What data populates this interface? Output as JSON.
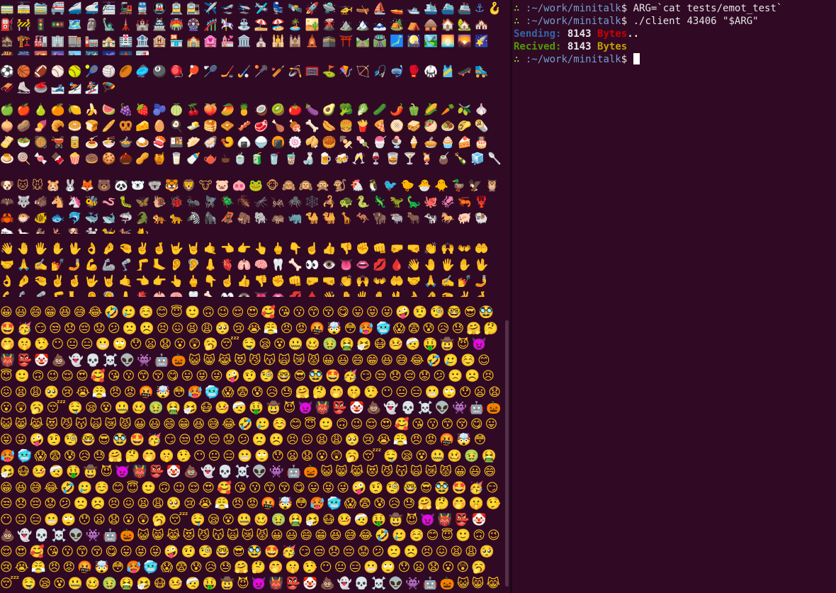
{
  "left_terminal": {
    "travel_emoji": "🚃🚋🚞🚝🚄🚅🚈🚂🚆🚇🚊🚉✈️🛫🛬🛩️💺🛰️🚀🛸🚁🛶⛵🚤🛥️🛳️⛴️🚢⚓🪝⛽🚧🚦🚥🗺️🗿🗽🗼🏰🏯🏟️🎡🎢🎠⛲⛱️🏖️🏝️🏜️🌋⛰️🏔️🗻🏕️⛺🛖🏠🏡🏘️🏚️🏗️🏭🏢🏬🏣🏤🏥🏦🏨🏪🏫🏩💒🏛️⛪🕌🕍🛕🕋⛩️🛤️🛣️🗾🎑🏞️🌅🌄🌠🎇🎆🌇🌆🏙️🌃🌌🌉🌁",
    "sport_emoji": "⚽🏀🏈⚾🥎🎾🏐🏉🥏🎱🪀🏓🏸🏒🏑🥍🏏🪃🥅⛳🪁🏹🎣🤿🥊🥋🎽🛹🛼🛷⛸️🥌🎿⛷️🏂🪂",
    "food_emoji": "🍏🍎🍐🍊🍋🍌🍉🍇🍓🫐🍈🍒🍑🥭🍍🥥🥝🍅🍆🥑🥦🥬🥒🌶️🫑🌽🥕🫒🧄🧅🥔🍠🥐🥯🍞🥖🥨🧀🥚🍳🧈🥞🧇🥓🥩🍗🍖🦴🌭🍔🍟🍕🫓🥪🥙🧆🌮🌯🫔🥗🥘🫕🥫🍝🍜🍲🍛🍣🍱🥟🦪🍤🍙🍚🍘🍥🥠🥮🍢🍡🍧🍨🍦🥧🧁🍰🎂🍮🍭🍬🍫🍿🍩🍪🌰🥜🍯🥛🍼🫖☕🍵🧃🥤🧋🍶🍺🍻🥂🍷🥃🍸🍹🧉🍾🧊🥄🍴🍽️🥣🥡🥢🧂",
    "animal_emoji": "🐶🐱🐭🐹🐰🦊🐻🐼🐻‍❄️🐨🐯🦁🐮🐷🐽🐸🐵🙈🙉🙊🐒🐔🐧🐦🐤🐣🐥🦆🦅🦉🦇🐺🐗🐴🦄🐝🪱🐛🦋🐌🐞🐜🪰🪲🪳🦟🦗🕷️🕸️🦂🐢🐍🦎🦖🦕🐙🦑🦐🦞🦀🐡🐠🐟🐬🐳🐋🦈🐊🐅🐆🦓🦍🦧🦣🐘🦛🦏🐪🐫🦒🦘🦬🐃🐂🐄🐎🐖🐏🐑🦙🐐🦌🐕🐩🦮🐕‍🦺🐈",
    "hands_emoji": "👋🤚🖐️✋🖖👌🤌🤏✌️🤞🤟🤘🤙👈👉👆🖕👇☝️👍👎✊👊🤛🤜👏🙌👐🤲🤝🙏✍️💅🤳💪🦾🦿🦵🦶👂🦻👃🫀🫁🧠🦷🦴👀👁️👅👄💋🩸👋🤚🖐️✋🖖👌🤌🤏✌️🤞🤟🤘🤙👈👉👆🖕👇☝️👍👎✊👊🤛🤜👏🙌👐🤲🤝🙏✍️💅🤳💪🦾🦿🦵🦶👂🦻👃🫀🫁🧠🦷🦴👀👁️👅👄💋🩸👋🤚🖐️✋🖖👌🤌🤏✌️🤞🤟🤘🤙👈👉👆🖕👇☝️👍👎✊👊🤛🤜👏🙌👐🤲🤝🙏✍️💅🤳💪🦾🦿🦵🦶👂🦻👃🫀🫁🧠🦷🦴👀👁️👅👄💋🩸",
    "faces_emoji": "😀😃😄😁😆😅😂🤣🥲☺️😊😇🙂🙃😉😌😍🥰😘😗😙😚😋😛😝😜🤪🤨🧐🤓😎🥸🤩🥳😏😒😞😔😟😕🙁☹️😣😖😫😩🥺😢😭😤😠😡🤬🤯😳🥵🥶😱😨😰😥😓🤗🤔🤭🤫🤥😶😐😑😬🙄😯😦😧😮😲🥱😴🤤😪😵🤐🥴🤢🤮🤧😷🤒🤕🤑🤠😈👿👹👺🤡💩👻💀☠️👽👾🤖🎃😺😸😹😻😼😽🙀😿😾😀😃😄😁😆😅😂🤣🥲☺️😊😇🙂🙃😉😌😍🥰😘😗😙😚😋😛😝😜🤪🤨🧐🤓😎🥸🤩🥳😏😒😞😔😟😕🙁☹️😣😖😫😩🥺😢😭😤😠😡🤬🤯😳🥵🥶😱😨😰😥😓🤗🤔🤭🤫🤥😶😐😑😬🙄😯😦😧😮😲🥱😴🤤😪😵🤐🥴🤢🤮🤧😷🤒🤕🤑🤠😈👿👹👺🤡💩👻💀☠️👽👾🤖🎃😺😸😹😻😼😽🙀😿😾😀😃😄😁😆😅😂🤣🥲☺️😊😇🙂🙃😉😌😍🥰😘😗😙😚😋😛😝😜🤪🤨🧐🤓😎🥸🤩🥳😏😒😞😔😟😕🙁☹️😣😖😫😩🥺😢😭😤😠😡🤬🤯😳🥵🥶😱😨😰😥😓🤗🤔🤭🤫🤥😶😐😑😬🙄😯😦😧😮😲🥱😴🤤😪😵🤐🥴🤢🤮🤧😷🤒🤕🤑🤠😈👿👹👺🤡💩👻💀☠️👽👾🤖🎃😺😸😹😻😼😽🙀😿😾😀😃😄😁😆😅😂🤣🥲☺️😊😇🙂🙃😉😌😍🥰😘😗😙😚😋😛😝😜🤪🤨🧐🤓😎🥸🤩🥳😏😒😞😔😟😕🙁☹️😣😖😫😩🥺😢😭😤😠😡🤬🤯😳🥵🥶😱😨😰😥😓🤗🤔🤭🤫🤥😶😐😑😬🙄😯😦😧😮😲🥱😴🤤😪😵🤐🥴🤢🤮🤧😷🤒🤕🤑🤠😈👿👹👺🤡💩👻💀☠️👽👾🤖🎃😺😸😹😻😼😽🙀😿😾😀😃😄😁😆😅😂🤣🥲☺️😊😇🙂🙃😉😌😍🥰😘😗😙😚😋😛😝😜🤪🤨🧐🤓😎🥸🤩🥳😏😒😞😔😟😕🙁☹️😣😖😫😩🥺😢😭😤😠😡🤬🤯😳🥵🥶😱😨😰😥😓🤗🤔🤭🤫🤥😶😐😑😬🙄😯😦😧😮😲🥱😴🤤😪😵🤐🥴🤢🤮🤧😷🤒🤕🤑🤠😈👿👹👺🤡💩👻💀☠️👽👾🤖🎃😺😸😹😻😼😽🙀😿😾🎃😺😸😹😻😼😽🙀😿😾"
  },
  "right_terminal": {
    "prompt_symbol": "∴",
    "prompt_path": ":~/work/minitalk",
    "prompt_dollar": "$",
    "cmd1": "ARG=`cat tests/emot_test`",
    "cmd2": "./client 43406 \"$ARG\"",
    "sending_label": "Sending:",
    "sending_value": "8143",
    "sending_unit": "Bytes",
    "sending_suffix": "..",
    "received_label": "Recived:",
    "received_value": "8143",
    "received_unit": "Bytes"
  },
  "colors": {
    "background": "#300a24",
    "prompt_green": "#8ae234",
    "path_blue": "#729fcf",
    "bytes_red": "#cc0000",
    "bytes_yellow": "#c4a000"
  }
}
